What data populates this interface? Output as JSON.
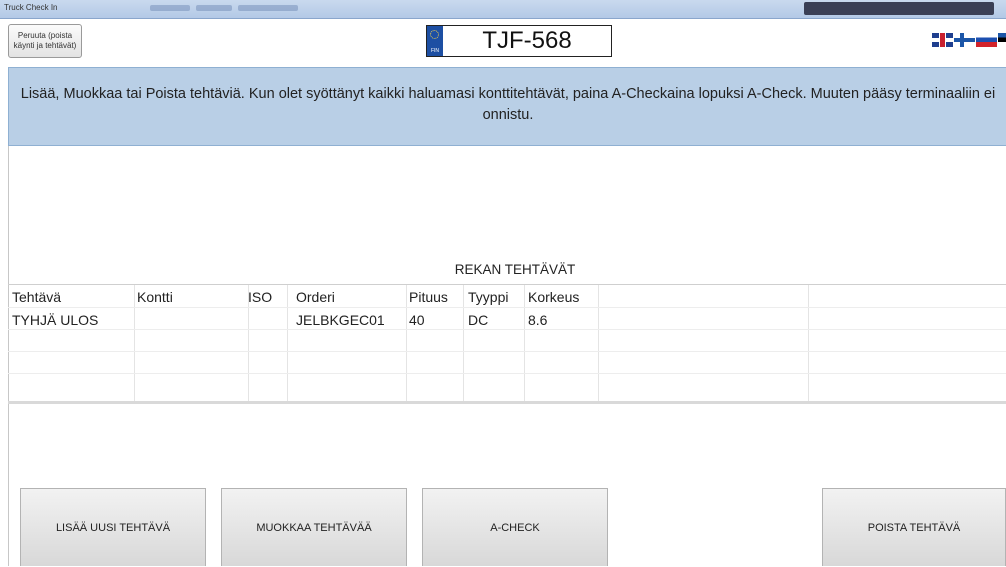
{
  "window": {
    "title": "Truck Check In"
  },
  "header": {
    "cancel_label_line1": "Peruuta (poista",
    "cancel_label_line2": "käynti ja tehtävät)",
    "plate": {
      "country": "FIN",
      "number": "TJF-568"
    },
    "languages": [
      "English",
      "Finnish",
      "Russian",
      "Estonian"
    ]
  },
  "info": {
    "message": "Lisää, Muokkaa tai Poista tehtäviä. Kun olet syöttänyt kaikki haluamasi konttitehtävät, paina A-Checkaina lopuksi A-Check. Muuten pääsy terminaaliin ei onnistu."
  },
  "tasks": {
    "title": "REKAN TEHTÄVÄT",
    "columns": [
      "Tehtävä",
      "Kontti",
      "ISO",
      "Orderi",
      "Pituus",
      "Tyyppi",
      "Korkeus"
    ],
    "rows": [
      [
        "TYHJÄ ULOS",
        "",
        "",
        "JELBKGEC01",
        "40",
        "DC",
        "8.6"
      ]
    ]
  },
  "actions": {
    "add": "LISÄÄ UUSI TEHTÄVÄ",
    "edit": "MUOKKAA TEHTÄVÄÄ",
    "acheck": "A-CHECK",
    "delete": "POISTA TEHTÄVÄ"
  }
}
